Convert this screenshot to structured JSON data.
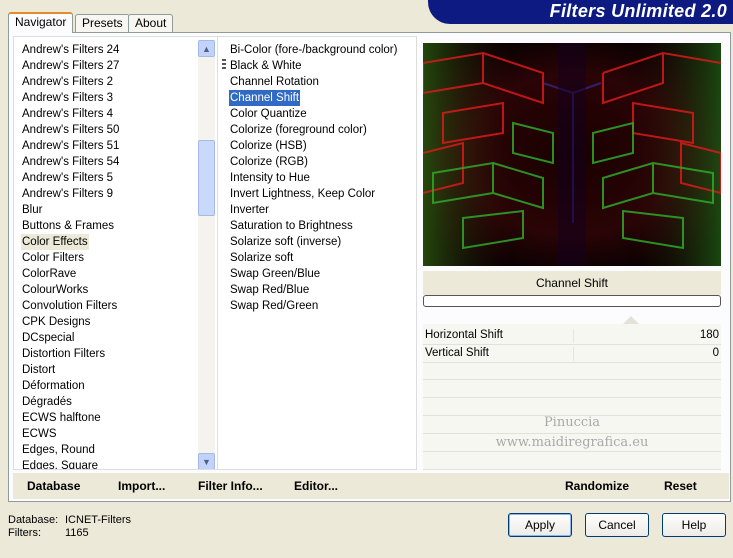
{
  "tabs": [
    "Navigator",
    "Presets",
    "About"
  ],
  "banner_title": "Filters Unlimited 2.0",
  "categories": [
    "Andrew's Filters 24",
    "Andrew's Filters 27",
    "Andrew's Filters 2",
    "Andrew's Filters 3",
    "Andrew's Filters 4",
    "Andrew's Filters 50",
    "Andrew's Filters 51",
    "Andrew's Filters 54",
    "Andrew's Filters 5",
    "Andrew's Filters 9",
    "Blur",
    "Buttons & Frames",
    "Color Effects",
    "Color Filters",
    "ColorRave",
    "ColourWorks",
    "Convolution Filters",
    "CPK Designs",
    "DCspecial",
    "Distortion Filters",
    "Distort",
    "Déformation",
    "Dégradés",
    "ECWS halftone",
    "ECWS",
    "Edges, Round",
    "Edges, Square"
  ],
  "selected_category": "Color Effects",
  "filters": [
    "Bi-Color (fore-/background color)",
    "Black & White",
    "Channel Rotation",
    "Channel Shift",
    "Color Quantize",
    "Colorize (foreground color)",
    "Colorize (HSB)",
    "Colorize (RGB)",
    "Intensity to Hue",
    "Invert Lightness, Keep Color",
    "Inverter",
    "Saturation to Brightness",
    "Solarize soft (inverse)",
    "Solarize soft",
    "Swap Green/Blue",
    "Swap Red/Blue",
    "Swap Red/Green"
  ],
  "selected_filter": "Channel Shift",
  "preview": {
    "filter_name": "Channel Shift",
    "progress": 0
  },
  "parameters": [
    {
      "label": "Horizontal Shift",
      "value": "180"
    },
    {
      "label": "Vertical Shift",
      "value": "0"
    }
  ],
  "watermark": {
    "line1": "Pinuccia",
    "line2": "www.maidiregrafica.eu"
  },
  "actions": {
    "database": "Database",
    "import": "Import...",
    "filter_info": "Filter Info...",
    "editor": "Editor...",
    "randomize": "Randomize",
    "reset": "Reset"
  },
  "status": {
    "database_label": "Database:",
    "database_value": "ICNET-Filters",
    "filters_label": "Filters:",
    "filters_value": "1165"
  },
  "buttons": {
    "apply": "Apply",
    "cancel": "Cancel",
    "help": "Help"
  },
  "colors": {
    "banner": "#0c1a82",
    "selection": "#316ac5",
    "accent_tab": "#e68b2c"
  }
}
